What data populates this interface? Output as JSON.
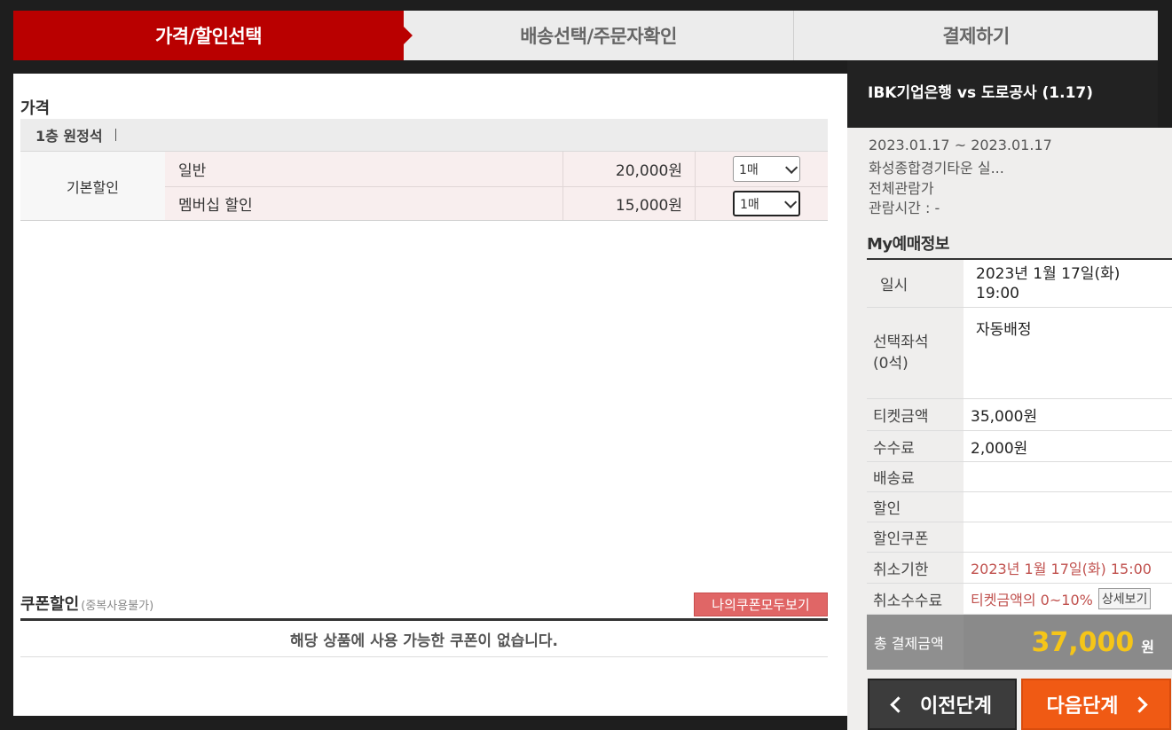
{
  "steps": [
    "가격/할인선택",
    "배송선택/주문자확인",
    "결제하기"
  ],
  "price": {
    "title": "가격",
    "grade": "1층 원정석",
    "group": "기본할인",
    "rows": [
      {
        "name": "일반",
        "price": "20,000원",
        "qty": "1매"
      },
      {
        "name": "멤버십 할인",
        "price": "15,000원",
        "qty": "1매"
      }
    ]
  },
  "coupon": {
    "title": "쿠폰할인",
    "note": "(중복사용불가)",
    "button": "나의쿠폰모두보기",
    "empty": "해당 상품에 사용 가능한 쿠폰이 없습니다."
  },
  "event": {
    "title": "IBK기업은행 vs 도로공사 (1.17)",
    "dates": "2023.01.17 ~ 2023.01.17",
    "venue": "화성종합경기타운 실...",
    "age": "전체관람가",
    "duration": "관람시간 : -"
  },
  "my": {
    "title": "My예매정보",
    "date_label": "일시",
    "date_line1": "2023년 1월 17일(화)",
    "date_line2": "19:00",
    "seat_label_1": "선택좌석",
    "seat_label_2": "(0석)",
    "seat_value": "자동배정",
    "ticket_label": "티켓금액",
    "ticket_value": "35,000원",
    "fee_label": "수수료",
    "fee_value": "2,000원",
    "delivery_label": "배송료",
    "delivery_value": "",
    "discount_label": "할인",
    "discount_value": "",
    "coupon_label": "할인쿠폰",
    "coupon_value": "",
    "cancel_deadline_label": "취소기한",
    "cancel_deadline_value": "2023년 1월 17일(화) 15:00",
    "cancel_fee_label": "취소수수료",
    "cancel_fee_value": "티켓금액의 0~10%",
    "detail_button": "상세보기",
    "total_label": "총 결제금액",
    "total_value": "37,000",
    "total_unit": "원"
  },
  "nav": {
    "prev": "이전단계",
    "next": "다음단계"
  }
}
